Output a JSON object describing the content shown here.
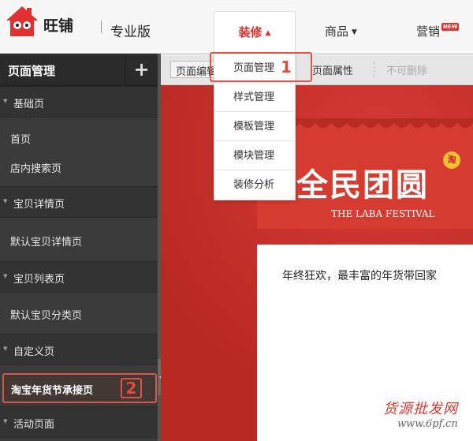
{
  "header": {
    "brand": "旺铺",
    "edition": "专业版",
    "nav": {
      "decorate": "装修",
      "goods": "商品",
      "marketing": "营销",
      "new_badge": "NEW"
    }
  },
  "dropdown": {
    "items": [
      "页面管理",
      "样式管理",
      "模板管理",
      "模块管理",
      "装修分析"
    ],
    "step_badge": "1"
  },
  "sidebar": {
    "title": "页面管理",
    "add_icon": "plus-icon",
    "groups": {
      "basic": "基础页",
      "item_detail": "宝贝详情页",
      "item_list": "宝贝列表页",
      "custom": "自定义页",
      "activity": "活动页面"
    },
    "pages": {
      "home": "首页",
      "store_search": "店内搜索页",
      "default_detail": "默认宝贝详情页",
      "default_category": "默认宝贝分类页",
      "festival": "淘宝年货节承接页"
    },
    "step_badge": "2"
  },
  "toolbar": {
    "edit": "页面编辑",
    "properties": "页面属性",
    "not_deletable": "不可删除"
  },
  "canvas": {
    "banner_title": "全民团圆",
    "banner_subtitle": "THE LABA FESTIVAL",
    "tao_badge": "淘",
    "card_text": "年终狂欢，最丰富的年货带回家"
  },
  "watermark": {
    "line1": "货源批发网",
    "line2": "www.6pf.cn"
  },
  "colors": {
    "accent": "#e0302f",
    "sidebar_bg": "#3b3b3b",
    "canvas_red": "#c9302a",
    "highlight": "#e0564a"
  }
}
